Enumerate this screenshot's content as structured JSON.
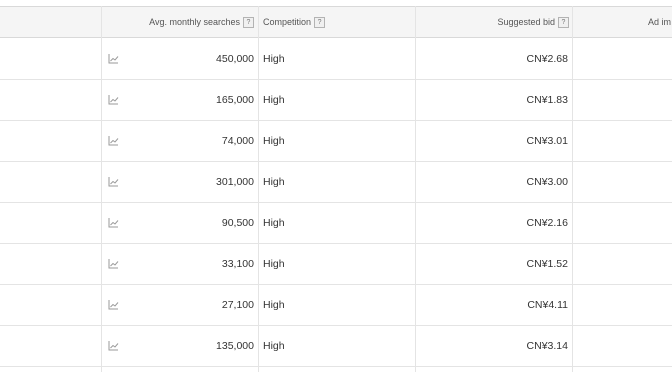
{
  "header": {
    "avg_monthly_searches": "Avg. monthly searches",
    "competition": "Competition",
    "suggested_bid": "Suggested bid",
    "ad_impr_share": "Ad im",
    "help_glyph": "?"
  },
  "rows": [
    {
      "searches": "450,000",
      "competition": "High",
      "bid": "CN¥2.68"
    },
    {
      "searches": "165,000",
      "competition": "High",
      "bid": "CN¥1.83"
    },
    {
      "searches": "74,000",
      "competition": "High",
      "bid": "CN¥3.01"
    },
    {
      "searches": "301,000",
      "competition": "High",
      "bid": "CN¥3.00"
    },
    {
      "searches": "90,500",
      "competition": "High",
      "bid": "CN¥2.16"
    },
    {
      "searches": "33,100",
      "competition": "High",
      "bid": "CN¥1.52"
    },
    {
      "searches": "27,100",
      "competition": "High",
      "bid": "CN¥4.11"
    },
    {
      "searches": "135,000",
      "competition": "High",
      "bid": "CN¥3.14"
    }
  ],
  "icons": {
    "trend": "line-chart-icon",
    "help": "help-icon"
  },
  "colors": {
    "header_bg": "#f5f5f5",
    "border": "#e4e4e4",
    "text": "#333333",
    "icon": "#9a9a9a"
  }
}
